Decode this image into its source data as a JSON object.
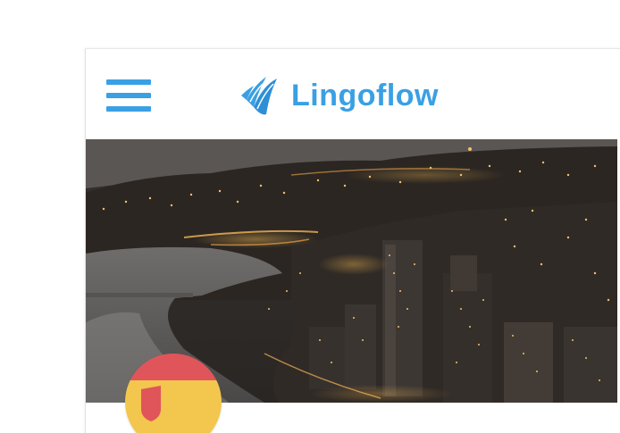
{
  "header": {
    "brand_name": "Lingoflow",
    "menu_icon": "hamburger-menu-icon",
    "logo_icon": "wave-logo-icon"
  },
  "hero": {
    "image": "night-city-coastline-photo"
  },
  "language": {
    "flag_icon": "spain-flag-icon"
  },
  "colors": {
    "brand_blue": "#3aa0e4",
    "flag_red": "#e0555a",
    "flag_yellow": "#f3c64e"
  }
}
